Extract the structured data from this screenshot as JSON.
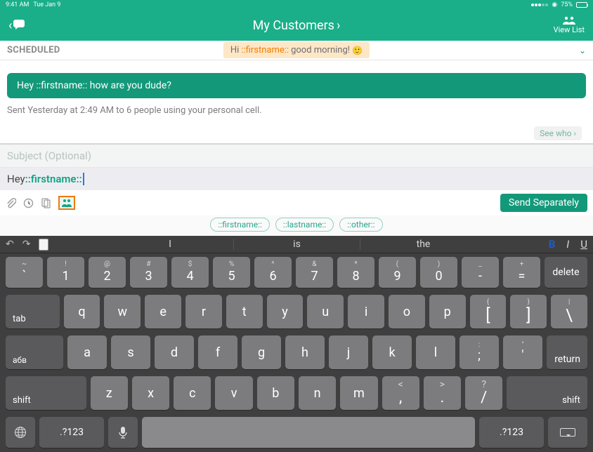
{
  "status": {
    "time": "9:41 AM",
    "date": "Tue Jan 9",
    "battery": "75%"
  },
  "header": {
    "title": "My Customers",
    "viewlist": "View List"
  },
  "scheduled": {
    "label": "SCHEDULED",
    "prefix": "Hi",
    "token": "::firstname::",
    "suffix": "good morning!",
    "emoji": "🙂"
  },
  "message": {
    "bubble": "Hey ::firstname:: how are you dude?",
    "info": "Sent Yesterday at 2:49 AM to 6 people using your personal cell.",
    "seewho": "See who ›"
  },
  "compose": {
    "subject_placeholder": "Subject (Optional)",
    "body_prefix": "Hey ",
    "body_token": "::firstname::",
    "send": "Send Separately",
    "tokens": [
      "::firstname::",
      "::lastname::",
      "::other::"
    ]
  },
  "keyboard": {
    "suggestions": [
      "I",
      "is",
      "the"
    ],
    "row_num_top": [
      "~",
      "!",
      "@",
      "#",
      "$",
      "%",
      "^",
      "&",
      "*",
      "(",
      ")",
      "_",
      "+"
    ],
    "row_num_mid": [
      "`",
      "1",
      "2",
      "3",
      "4",
      "5",
      "6",
      "7",
      "8",
      "9",
      "0",
      "-",
      "="
    ],
    "delete": "delete",
    "row_q": [
      "q",
      "w",
      "e",
      "r",
      "t",
      "y",
      "u",
      "i",
      "o",
      "p"
    ],
    "row_q_br_top": [
      "{",
      "}",
      "|"
    ],
    "row_q_br_mid": [
      "[",
      "]",
      "\\"
    ],
    "tab": "tab",
    "row_a": [
      "a",
      "s",
      "d",
      "f",
      "g",
      "h",
      "j",
      "k",
      "l"
    ],
    "row_a_p_top": [
      ":",
      "\""
    ],
    "row_a_p_mid": [
      ";",
      "'"
    ],
    "abv": "абв",
    "return": "return",
    "row_z": [
      "z",
      "x",
      "c",
      "v",
      "b",
      "n",
      "m"
    ],
    "row_z_p_top": [
      "<",
      ">",
      "?"
    ],
    "row_z_p_mid": [
      ",",
      ".",
      "/"
    ],
    "shift": "shift",
    "num": ".?123"
  }
}
